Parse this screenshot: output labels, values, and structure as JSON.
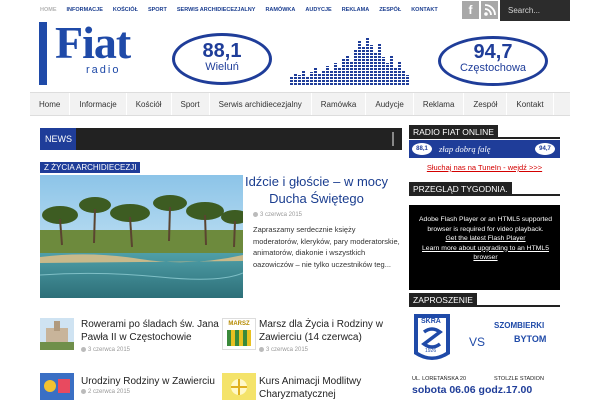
{
  "top_nav": [
    "HOME",
    "INFORMACJE",
    "KOŚCIÓŁ",
    "SPORT",
    "SERWIS ARCHIDIECEZJALNY",
    "RAMÓWKA",
    "AUDYCJE",
    "REKLAMA",
    "ZESPÓŁ",
    "KONTAKT"
  ],
  "social": {
    "facebook_icon": "f",
    "rss_icon": "rss"
  },
  "search": {
    "placeholder": "Search..."
  },
  "header": {
    "logo": "Fiat",
    "logo_sub": "radio",
    "station1_freq": "88,1",
    "station1_city": "Wieluń",
    "station2_freq": "94,7",
    "station2_city": "Częstochowa"
  },
  "main_nav": [
    "Home",
    "Informacje",
    "Kościół",
    "Sport",
    "Serwis archidiecezjalny",
    "Ramówka",
    "Audycje",
    "Reklama",
    "Zespół",
    "Kontakt"
  ],
  "ticker": {
    "label": "NEWS"
  },
  "featured": {
    "category": "Z ŻYCIA ARCHIDIECEZJI",
    "title": "Idźcie i głoście – w mocy Ducha Świętego",
    "date": "3 czerwca 2015",
    "excerpt": "Zapraszamy serdecznie księży moderatorów, kleryków, pary moderatorskie, animatorów, diakonie i wszystkich oazowiczów – nie tylko uczestników teg..."
  },
  "posts": [
    {
      "title": "Rowerami po śladach św. Jana Pawła II w Częstochowie",
      "date": "3 czerwca 2015"
    },
    {
      "title": "Marsz dla Życia i Rodziny w Zawierciu (14 czerwca)",
      "date": "3 czerwca 2015",
      "thumb_text": "MARSZ"
    },
    {
      "title": "Urodziny Rodziny w Zawierciu",
      "date": "2 czerwca 2015"
    },
    {
      "title": "Kurs Animacji Modlitwy Charyzmatycznej",
      "date": ""
    }
  ],
  "sidebar": {
    "radio_header": "RADIO FIAT ONLINE",
    "radio_slogan": "złap dobrą falę",
    "radio_p1": "88,1",
    "radio_p2": "94,7",
    "tunein": "Słuchaj nas na TuneIn - wejdź >>>",
    "week_header": "PRZEGLĄD TYGODNIA.",
    "flash_line1": "Adobe Flash Player or an HTML5 supported browser is required for video playback.",
    "flash_link1": "Get the latest Flash Player",
    "flash_link2": "Learn more about upgrading to an HTML5 browser",
    "invite_header": "ZAPROSZENIE",
    "poster_team1": "SKRA",
    "poster_year": "1926",
    "poster_vs": "VS",
    "poster_team2_a": "SZOMBIERKI",
    "poster_team2_b": "BYTOM",
    "poster_address": "UL. LORETAŃSKA 20",
    "poster_venue": "STOLZLE STADION",
    "poster_when": "sobota 06.06 godz.17.00"
  },
  "colors": {
    "brand_blue": "#1f3d99",
    "dark": "#222222",
    "link_red": "#d40000"
  }
}
